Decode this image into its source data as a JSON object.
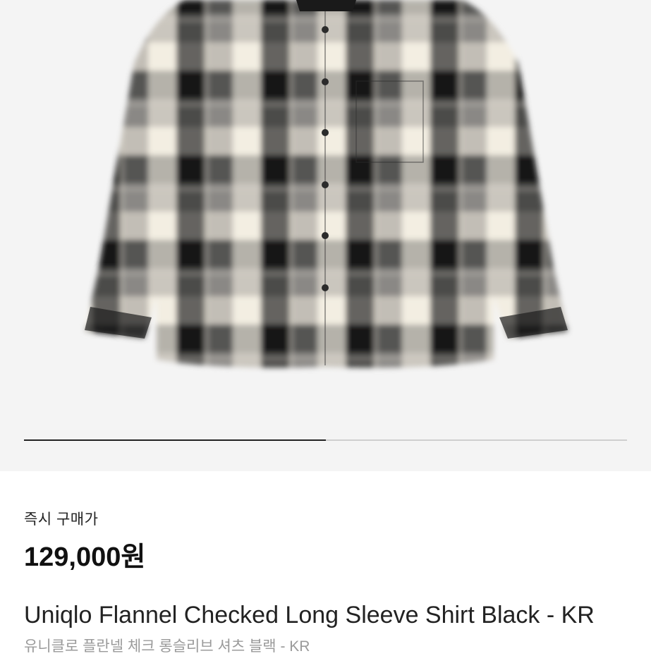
{
  "product": {
    "image_icon": "plaid-flannel-shirt-image",
    "gallery_progress": 0.5,
    "price_label": "즉시 구매가",
    "price": "129,000원",
    "name_en": "Uniqlo Flannel Checked Long Sleeve Shirt Black - KR",
    "name_ko": "유니클로 플란넬 체크 롱슬리브 셔츠 블랙 - KR"
  },
  "colors": {
    "background": "#f4f4f4",
    "check_dark": "#1e1e1e",
    "check_light": "#f1ecdf",
    "progress_active": "#222222",
    "progress_track": "#cfcfcf"
  }
}
